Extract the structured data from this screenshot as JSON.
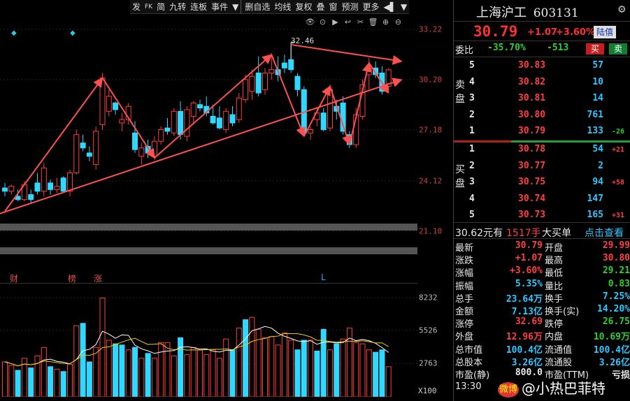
{
  "toolbar": {
    "items": [
      "发",
      "FK",
      "简",
      "九转",
      "连板",
      "事件",
      "▼",
      "删自选",
      "均线",
      "复权",
      "叠",
      "窗",
      "预测",
      "更多",
      "◀▌",
      "▼"
    ]
  },
  "chart_tools": [
    "👁",
    "⊙",
    "▶",
    "↩",
    "✂",
    "🗑",
    "⊕",
    "⊖"
  ],
  "price_axis": [
    "33.22",
    "30.20",
    "27.18",
    "24.12",
    "21.10"
  ],
  "volume_axis": [
    "8232",
    "5526",
    "2763"
  ],
  "volume_unit": "X100",
  "peak_label": "32.46",
  "tags": {
    "cai": "财",
    "bang": "榜",
    "zhang": "涨",
    "l": "L"
  },
  "quote": {
    "name": "上海沪工",
    "code": "603131",
    "price": "30.79",
    "change": "+1.07",
    "change_pct": "+3.60%",
    "badge": "陆僖",
    "weibi_label": "委比",
    "weibi_pct": "-35.70%",
    "weibi_diff": "-513",
    "buy_btn": "买",
    "sell_btn": "卖",
    "sell_side_label": "卖盘",
    "buy_side_label": "买盘",
    "asks": [
      {
        "level": "5",
        "price": "30.83",
        "vol": "57",
        "delta": ""
      },
      {
        "level": "4",
        "price": "30.82",
        "vol": "10",
        "delta": ""
      },
      {
        "level": "3",
        "price": "30.81",
        "vol": "14",
        "delta": ""
      },
      {
        "level": "2",
        "price": "30.80",
        "vol": "761",
        "delta": ""
      },
      {
        "level": "1",
        "price": "30.79",
        "vol": "133",
        "delta": "-26"
      }
    ],
    "bids": [
      {
        "level": "1",
        "price": "30.78",
        "vol": "54",
        "delta": "+21"
      },
      {
        "level": "2",
        "price": "30.77",
        "vol": "2",
        "delta": ""
      },
      {
        "level": "3",
        "price": "30.75",
        "vol": "94",
        "delta": "+58"
      },
      {
        "level": "4",
        "price": "30.74",
        "vol": "147",
        "delta": ""
      },
      {
        "level": "5",
        "price": "30.73",
        "vol": "165",
        "delta": "+31"
      }
    ],
    "big_order": {
      "amount": "30.62元有",
      "hands": "1517手",
      "label": "大买单",
      "link": "点击查看"
    },
    "stats": [
      {
        "l1": "最新",
        "v1": "30.79",
        "c1": "red",
        "l2": "开盘",
        "v2": "29.99",
        "c2": "red"
      },
      {
        "l1": "涨跌",
        "v1": "+1.07",
        "c1": "red",
        "l2": "最高",
        "v2": "30.80",
        "c2": "red"
      },
      {
        "l1": "涨幅",
        "v1": "+3.60%",
        "c1": "red",
        "l2": "最低",
        "v2": "29.21",
        "c2": "green"
      },
      {
        "l1": "振幅",
        "v1": "5.35%",
        "c1": "cyan",
        "l2": "量比",
        "v2": "0.83",
        "c2": "green"
      },
      {
        "l1": "总手",
        "v1": "23.64万",
        "c1": "cyan",
        "l2": "换手",
        "v2": "7.25%",
        "c2": "cyan"
      },
      {
        "l1": "金额",
        "v1": "7.13亿",
        "c1": "cyan",
        "l2": "换手(实)",
        "v2": "14.20%",
        "c2": "cyan"
      },
      {
        "l1": "涨停",
        "v1": "32.69",
        "c1": "red",
        "l2": "跌停",
        "v2": "26.75",
        "c2": "green"
      },
      {
        "l1": "外盘",
        "v1": "12.96万",
        "c1": "red",
        "l2": "内盘",
        "v2": "10.69万",
        "c2": "green"
      },
      {
        "l1": "总市值",
        "v1": "100.4亿",
        "c1": "cyan",
        "l2": "流通值",
        "v2": "100.4亿",
        "c2": "cyan"
      },
      {
        "l1": "总股本",
        "v1": "3.26亿",
        "c1": "cyan",
        "l2": "流通股",
        "v2": "3.26亿",
        "c2": "cyan"
      },
      {
        "l1": "市盈(静)",
        "v1": "800.0",
        "c1": "white",
        "l2": "市盈(TTM)",
        "v2": "亏损",
        "c2": "white"
      }
    ],
    "time": "13:30"
  },
  "watermark": {
    "logo": "微博",
    "text": "@小热巴菲特"
  },
  "chart_data": {
    "type": "candlestick",
    "ylim": [
      21.1,
      33.22
    ],
    "yticks": [
      33.22,
      30.2,
      27.18,
      24.12,
      21.1
    ],
    "candles": [
      [
        23.7,
        24.0,
        23.2,
        23.5
      ],
      [
        23.5,
        23.9,
        23.3,
        23.8
      ],
      [
        23.2,
        23.6,
        22.9,
        23.0
      ],
      [
        23.0,
        24.1,
        22.9,
        23.9
      ],
      [
        23.3,
        23.6,
        22.8,
        23.0
      ],
      [
        24.0,
        24.6,
        23.3,
        23.5
      ],
      [
        23.5,
        25.2,
        23.2,
        24.9
      ],
      [
        24.0,
        24.2,
        23.3,
        23.6
      ],
      [
        23.6,
        24.3,
        23.4,
        23.8
      ],
      [
        24.3,
        24.4,
        23.4,
        23.5
      ],
      [
        23.5,
        24.8,
        23.2,
        24.6
      ],
      [
        24.6,
        27.2,
        24.5,
        26.9
      ],
      [
        26.4,
        26.9,
        25.9,
        26.1
      ],
      [
        25.8,
        26.2,
        25.3,
        25.6
      ],
      [
        25.1,
        27.4,
        24.8,
        27.1
      ],
      [
        27.5,
        30.6,
        27.2,
        30.3
      ],
      [
        28.3,
        29.6,
        28.0,
        29.2
      ],
      [
        28.8,
        28.9,
        28.1,
        28.4
      ],
      [
        27.6,
        28.2,
        27.1,
        27.8
      ],
      [
        27.8,
        28.8,
        27.5,
        28.6
      ],
      [
        27.0,
        27.7,
        25.8,
        26.0
      ],
      [
        25.6,
        26.4,
        25.1,
        26.1
      ],
      [
        26.2,
        26.6,
        25.5,
        25.8
      ],
      [
        25.6,
        26.8,
        25.4,
        26.5
      ],
      [
        26.5,
        27.4,
        26.3,
        27.2
      ],
      [
        27.3,
        27.9,
        26.9,
        27.1
      ],
      [
        27.0,
        28.5,
        26.8,
        28.3
      ],
      [
        28.3,
        28.9,
        26.6,
        26.9
      ],
      [
        26.8,
        28.6,
        26.5,
        28.4
      ],
      [
        28.0,
        28.9,
        27.5,
        28.8
      ],
      [
        28.7,
        29.0,
        28.3,
        28.5
      ],
      [
        28.6,
        29.2,
        28.0,
        28.2
      ],
      [
        28.0,
        28.7,
        27.5,
        27.6
      ],
      [
        27.9,
        28.6,
        27.2,
        27.3
      ],
      [
        27.2,
        28.5,
        27.0,
        28.3
      ],
      [
        28.1,
        28.6,
        27.4,
        27.6
      ],
      [
        27.8,
        29.4,
        27.6,
        29.1
      ],
      [
        29.0,
        30.5,
        28.8,
        30.2
      ],
      [
        29.5,
        30.8,
        29.0,
        30.4
      ],
      [
        30.6,
        31.6,
        29.2,
        29.4
      ],
      [
        29.6,
        30.9,
        29.3,
        30.6
      ],
      [
        30.6,
        31.8,
        30.2,
        30.8
      ],
      [
        30.8,
        31.6,
        30.1,
        30.5
      ],
      [
        31.2,
        31.7,
        30.6,
        30.9
      ],
      [
        31.4,
        32.3,
        30.6,
        30.8
      ],
      [
        30.4,
        30.6,
        29.2,
        29.6
      ],
      [
        29.6,
        29.8,
        26.8,
        27.0
      ],
      [
        27.0,
        27.4,
        26.6,
        27.2
      ],
      [
        27.8,
        28.5,
        27.4,
        28.2
      ],
      [
        28.2,
        28.5,
        27.1,
        27.2
      ],
      [
        27.3,
        29.9,
        27.1,
        29.6
      ],
      [
        28.6,
        29.0,
        27.8,
        28.3
      ],
      [
        28.8,
        29.2,
        26.9,
        27.1
      ],
      [
        26.9,
        27.1,
        26.1,
        26.3
      ],
      [
        26.3,
        28.5,
        26.1,
        28.1
      ],
      [
        28.0,
        30.2,
        27.8,
        29.9
      ],
      [
        30.5,
        31.5,
        29.6,
        30.9
      ],
      [
        30.9,
        31.3,
        30.3,
        30.5
      ],
      [
        30.6,
        31.0,
        29.3,
        29.5
      ],
      [
        29.8,
        30.9,
        29.6,
        30.79
      ]
    ],
    "volumes": [
      [
        2900,
        "red"
      ],
      [
        2600,
        "red"
      ],
      [
        2200,
        "cyan"
      ],
      [
        3200,
        "red"
      ],
      [
        2400,
        "cyan"
      ],
      [
        3400,
        "red"
      ],
      [
        4100,
        "red"
      ],
      [
        2500,
        "cyan"
      ],
      [
        2300,
        "red"
      ],
      [
        2100,
        "cyan"
      ],
      [
        2700,
        "red"
      ],
      [
        5900,
        "red"
      ],
      [
        6100,
        "cyan"
      ],
      [
        2900,
        "cyan"
      ],
      [
        4100,
        "red"
      ],
      [
        8200,
        "red"
      ],
      [
        4700,
        "red"
      ],
      [
        4400,
        "cyan"
      ],
      [
        4300,
        "cyan"
      ],
      [
        3900,
        "red"
      ],
      [
        4100,
        "cyan"
      ],
      [
        3200,
        "red"
      ],
      [
        3600,
        "cyan"
      ],
      [
        3200,
        "red"
      ],
      [
        4500,
        "red"
      ],
      [
        4500,
        "red"
      ],
      [
        3400,
        "red"
      ],
      [
        4900,
        "cyan"
      ],
      [
        3500,
        "red"
      ],
      [
        4100,
        "red"
      ],
      [
        3900,
        "red"
      ],
      [
        3500,
        "red"
      ],
      [
        3900,
        "red"
      ],
      [
        3200,
        "red"
      ],
      [
        4800,
        "red"
      ],
      [
        3900,
        "cyan"
      ],
      [
        5700,
        "red"
      ],
      [
        6400,
        "cyan"
      ],
      [
        6600,
        "red"
      ],
      [
        5600,
        "red"
      ],
      [
        4900,
        "red"
      ],
      [
        5000,
        "red"
      ],
      [
        4300,
        "red"
      ],
      [
        5300,
        "red"
      ],
      [
        4700,
        "red"
      ],
      [
        3900,
        "cyan"
      ],
      [
        4700,
        "cyan"
      ],
      [
        4700,
        "red"
      ],
      [
        3800,
        "cyan"
      ],
      [
        5600,
        "cyan"
      ],
      [
        3900,
        "red"
      ],
      [
        4400,
        "cyan"
      ],
      [
        4800,
        "red"
      ],
      [
        5700,
        "red"
      ],
      [
        4500,
        "red"
      ],
      [
        4400,
        "red"
      ],
      [
        3900,
        "red"
      ],
      [
        3700,
        "cyan"
      ],
      [
        3900,
        "cyan"
      ],
      [
        2500,
        "red"
      ]
    ],
    "vol_max": 8232,
    "trend_lines": [
      [
        [
          0,
          22.3
        ],
        [
          15,
          30.3
        ]
      ],
      [
        [
          15,
          30.3
        ],
        [
          23,
          25.5
        ]
      ],
      [
        [
          23,
          25.5
        ],
        [
          41,
          31.7
        ]
      ],
      [
        [
          41,
          31.7
        ],
        [
          46,
          26.8
        ]
      ],
      [
        [
          46,
          26.8
        ],
        [
          50,
          29.8
        ]
      ],
      [
        [
          50,
          29.8
        ],
        [
          53,
          26.3
        ]
      ],
      [
        [
          53,
          26.3
        ],
        [
          56,
          31.2
        ]
      ],
      [
        [
          56,
          31.2
        ],
        [
          59,
          29.4
        ]
      ],
      [
        [
          -2,
          22.0
        ],
        [
          61,
          30.2
        ]
      ],
      [
        [
          44,
          32.3
        ],
        [
          61,
          31.3
        ]
      ]
    ]
  }
}
